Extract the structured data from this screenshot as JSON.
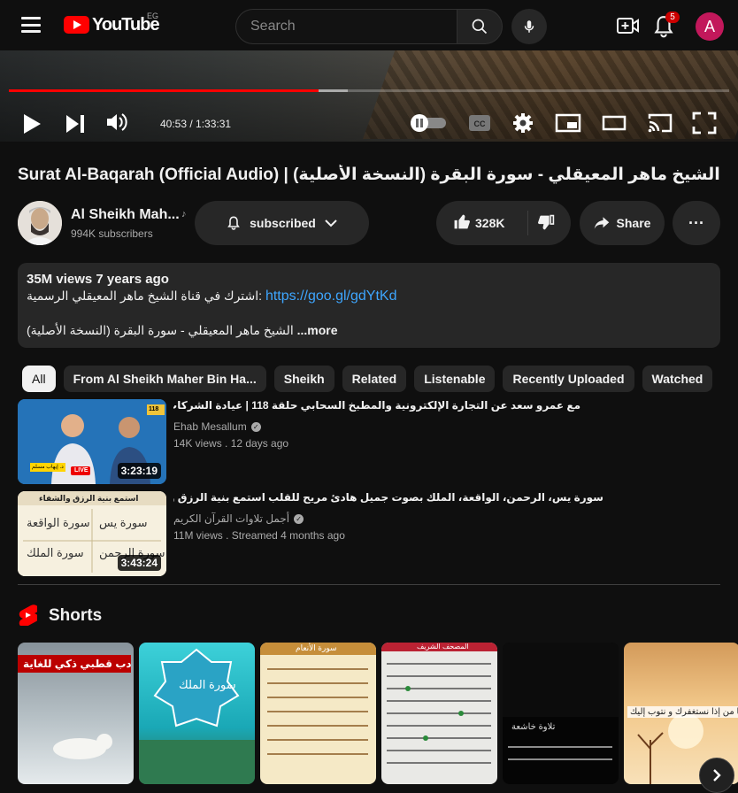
{
  "header": {
    "logo_text": "YouTube",
    "country_code": "EG",
    "search_placeholder": "Search",
    "notification_count": "5",
    "avatar_letter": "A"
  },
  "player": {
    "time": "40:53 / 1:33:31",
    "progress": 0.43,
    "buffered": 0.47
  },
  "video": {
    "title": "الشيخ ماهر المعيقلي - سورة البقرة (النسخة الأصلية) | (Surat Al-Baqarah (Official Audio",
    "channel_name": "Al Sheikh Mah...",
    "channel_note": "♪",
    "subscribers": "994K subscribers",
    "subscribe_label": "subscribed",
    "like_count": "328K",
    "share_label": "Share",
    "more_label": "···"
  },
  "description": {
    "stats": "35M views 7 years ago",
    "line1_text": "اشترك في قناة الشيخ ماهر المعيقلي الرسمية: ",
    "line1_link": "https://goo.gl/gdYtKd",
    "line2_text": "الشيخ ماهر المعيقلي - سورة البقرة (النسخة الأصلية)",
    "more": "...more"
  },
  "chips": [
    "All",
    "From Al Sheikh Maher Bin Ha...",
    "Sheikh",
    "Related",
    "Listenable",
    "Recently Uploaded",
    "Watched"
  ],
  "recommendations": [
    {
      "title": "مع عمرو سعد عن التجارة الإلكترونية والمطبخ السحابي حلقة 118 | عيادة الشركات | د. إيهاب مسلم",
      "channel": "Ehab Mesallum",
      "meta": "14K views . 12 days ago",
      "duration": "3:23:19",
      "thumb_episode": "118",
      "thumb_live": "LIVE",
      "thumb_name": "د. إيهاب مسلم"
    },
    {
      "title": "سورة يس، الرحمن، الواقعة، الملك بصوت جميل هادئ مريح للقلب استمع بنية الرزق والبركة وتيسير الأمور",
      "channel": "أجمل تلاوات القرآن الكريم",
      "meta": "11M views . Streamed 4 months ago",
      "duration": "3:43:24",
      "thumb_header": "استمع بنية الرزق والشفاء",
      "thumb_surahs": [
        "سورة يس",
        "سورة الواقعة",
        "سورة الرحمن",
        "سورة الملك"
      ]
    }
  ],
  "shorts": {
    "label": "Shorts",
    "items": [
      {
        "caption": "دب قطبي ذكي للغاية"
      },
      {
        "caption": "سورة الملك"
      },
      {
        "caption": "سورة الأنعام"
      },
      {
        "caption": "المصحف الشريف"
      },
      {
        "caption": "تلاوة خاشعة"
      },
      {
        "caption": "يا من إذا نستغفرك و نتوب إليك"
      }
    ]
  },
  "colors": {
    "background": "#0f0f0f",
    "accent": "#ff0000",
    "link": "#3ea6ff",
    "chip_bg": "#272727"
  }
}
